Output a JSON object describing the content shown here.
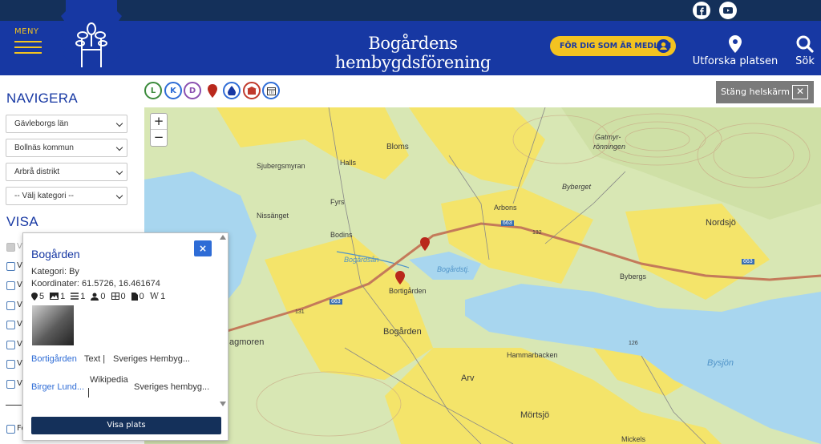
{
  "header": {
    "menu_label": "MENY",
    "site_title": "Bogårdens hembygdsförening",
    "member_button": "FÖR DIG SOM ÄR MEDLEM",
    "explore_label": "Utforska platsen",
    "search_label": "Sök",
    "social": [
      "facebook-icon",
      "youtube-icon"
    ],
    "colors": {
      "topstrip": "#14305a",
      "header": "#1738a3",
      "accent": "#f3c320"
    }
  },
  "sidebar": {
    "nav_title": "NAVIGERA",
    "selects": [
      "Gävleborgs län",
      "Bollnäs kommun",
      "Arbrå distrikt",
      "-- Välj kategori --"
    ],
    "show_title": "VISA",
    "checkbox_labels": [
      "Vi",
      "Vi",
      "Vi",
      "Vi",
      "Vi",
      "Vi",
      "Vi",
      "Vi"
    ],
    "bottom_label": "Fö"
  },
  "map": {
    "filter_icons": [
      {
        "letter": "L",
        "color": "#3b8a3b"
      },
      {
        "letter": "K",
        "color": "#2e6cd6"
      },
      {
        "letter": "D",
        "color": "#8a4fb0"
      }
    ],
    "fullscreen_close": "Stäng helskärm",
    "zoom_in": "+",
    "zoom_out": "−",
    "labels": {
      "bloms": "Bloms",
      "halls": "Halls",
      "sjubergsmyran": "Sjubergsmyran",
      "gatmyr": "Gatmyr-",
      "ronningen": "rönningen",
      "byberget": "Byberget",
      "fyrs": "Fyrs",
      "arbons": "Arbons",
      "nissanget": "Nissänget",
      "bodins": "Bodins",
      "nordsjo": "Nordsjö",
      "bogardsan": "Bogårdsån",
      "bogardstj": "Bogårdstj.",
      "bortigarden": "Bortigården",
      "bybergs": "Bybergs",
      "bogarden": "Bogården",
      "magmoren": "agmoren",
      "hammarbacken": "Hammarbacken",
      "bysjon": "Bysjön",
      "arv": "Arv",
      "mortsjo": "Mörtsjö",
      "mickels": "Mickels",
      "road1": "663",
      "road2": "663",
      "road3": "663",
      "elev1": "132",
      "elev2": "131",
      "elev3": "126"
    }
  },
  "popup": {
    "title": "Bogården",
    "category": "Kategori: By",
    "coordinates": "Koordinater: 61.5726, 16.461674",
    "stats": [
      "5",
      "1",
      "1",
      "0",
      "0",
      "0",
      "1"
    ],
    "wiki_letter": "W",
    "links": [
      {
        "name": "Bortigården",
        "type": "Text |",
        "source": "Sveriges Hembyg..."
      },
      {
        "name": "Birger Lund...",
        "type": "Wikipedia",
        "source": "Sveriges hembyg..."
      }
    ],
    "show_button": "Visa plats",
    "close_symbol": "×"
  }
}
